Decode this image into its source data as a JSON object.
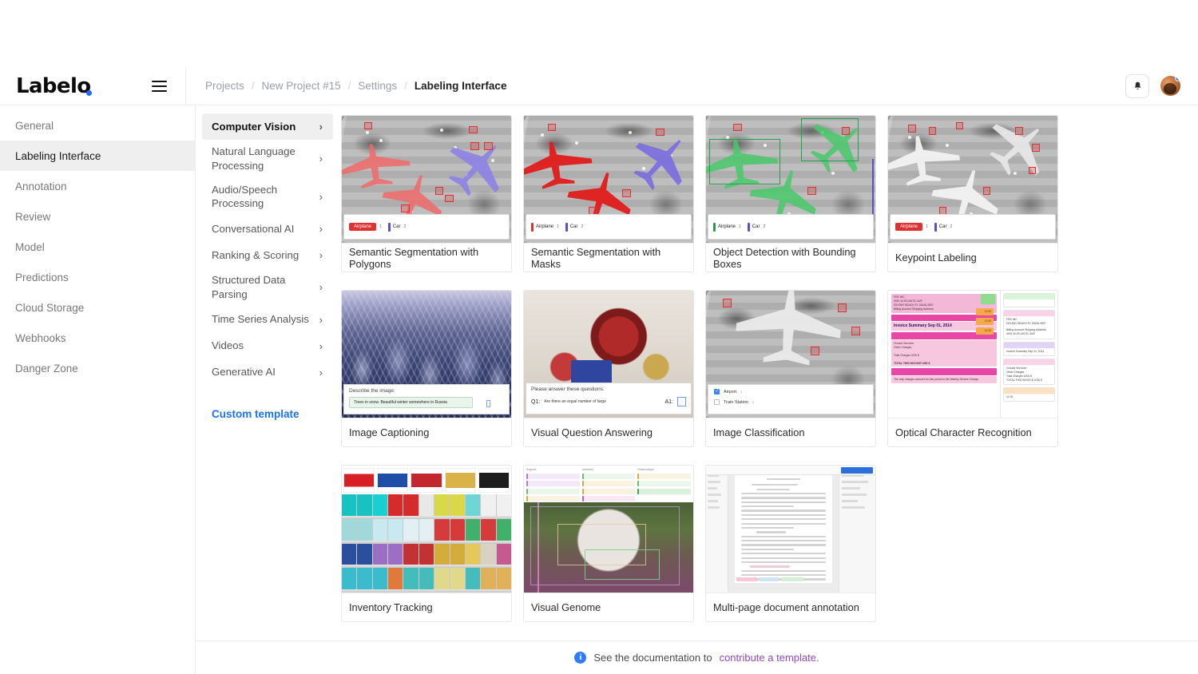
{
  "app": {
    "logo_text": "Label",
    "logo_accent_color": "#1f6bff"
  },
  "header": {
    "menu_icon": "hamburger-icon",
    "bell_icon": "bell-icon",
    "avatar_label": "user-avatar",
    "breadcrumb": [
      {
        "label": "Projects",
        "current": false
      },
      {
        "label": "New Project #15",
        "current": false
      },
      {
        "label": "Settings",
        "current": false
      },
      {
        "label": "Labeling Interface",
        "current": true
      }
    ],
    "separator": "/"
  },
  "sidebar": {
    "items": [
      {
        "label": "General",
        "active": false
      },
      {
        "label": "Labeling Interface",
        "active": true
      },
      {
        "label": "Annotation",
        "active": false
      },
      {
        "label": "Review",
        "active": false
      },
      {
        "label": "Model",
        "active": false
      },
      {
        "label": "Predictions",
        "active": false
      },
      {
        "label": "Cloud Storage",
        "active": false
      },
      {
        "label": "Webhooks",
        "active": false
      },
      {
        "label": "Danger Zone",
        "active": false
      }
    ]
  },
  "categories": {
    "items": [
      {
        "label": "Computer Vision",
        "active": true
      },
      {
        "label": "Natural Language Processing",
        "active": false
      },
      {
        "label": "Audio/Speech Processing",
        "active": false
      },
      {
        "label": "Conversational AI",
        "active": false
      },
      {
        "label": "Ranking & Scoring",
        "active": false
      },
      {
        "label": "Structured Data Parsing",
        "active": false
      },
      {
        "label": "Time Series Analysis",
        "active": false
      },
      {
        "label": "Videos",
        "active": false
      },
      {
        "label": "Generative AI",
        "active": false
      }
    ],
    "chevron": "›",
    "custom_template_label": "Custom template"
  },
  "templates": [
    {
      "title": "Semantic Segmentation with Polygons",
      "preview": "aerial-polygons",
      "tags": [
        {
          "text": "Airplane",
          "hotkey": "1",
          "color": "#e03131",
          "style": "chip"
        },
        {
          "text": "Car",
          "hotkey": "2",
          "color": "#5b4fcf",
          "style": "swatch"
        }
      ]
    },
    {
      "title": "Semantic Segmentation with Masks",
      "preview": "aerial-masks",
      "tags": [
        {
          "text": "Airplane",
          "hotkey": "1",
          "color": "#e03131",
          "style": "swatch"
        },
        {
          "text": "Car",
          "hotkey": "2",
          "color": "#5b4fcf",
          "style": "swatch"
        }
      ]
    },
    {
      "title": "Object Detection with Bounding Boxes",
      "preview": "aerial-boxes",
      "tags": [
        {
          "text": "Airplane",
          "hotkey": "1",
          "color": "#22a04a",
          "style": "swatch"
        },
        {
          "text": "Car",
          "hotkey": "2",
          "color": "#5b4fcf",
          "style": "swatch"
        }
      ]
    },
    {
      "title": "Keypoint Labeling",
      "preview": "aerial-keypoints",
      "tags": [
        {
          "text": "Airplane",
          "hotkey": "1",
          "color": "#e03131",
          "style": "chip"
        },
        {
          "text": "Car",
          "hotkey": "2",
          "color": "#5b4fcf",
          "style": "swatch"
        }
      ]
    },
    {
      "title": "Image Captioning",
      "preview": "snow-trees",
      "caption": {
        "prompt": "Describe the image:",
        "answer": "Trees in snow. Beautiful winter somewhere in Russia"
      }
    },
    {
      "title": "Visual Question Answering",
      "preview": "vqa-objects",
      "vqa": {
        "prompt": "Please answer these questions:",
        "question_label": "Q1:",
        "question_text": "Are there an equal number of large",
        "answer_label": "A1:"
      }
    },
    {
      "title": "Image Classification",
      "preview": "aerial-classification",
      "choices": [
        {
          "label": "Airport",
          "hotkey": "1",
          "checked": true
        },
        {
          "label": "Train Station",
          "hotkey": "2",
          "checked": false
        }
      ]
    },
    {
      "title": "Optical Character Recognition",
      "preview": "ocr-invoice",
      "ocr": {
        "blocks": [
          "FRS INC",
          "4931 W ATLANTIC AVE",
          "DELRAY BEACH FL 33445-3907",
          "Billing Account Shipping Address:",
          "Invoice Summary Sep 01, 2014",
          "Ground Services",
          "Other Charges",
          "Total Charges USD $",
          "TOTAL THIS INVOICE USD $",
          "11.00",
          "The only charges accrued for this period is the Weekly Service Charge."
        ]
      }
    },
    {
      "title": "Inventory Tracking",
      "preview": "retail-shelf"
    },
    {
      "title": "Visual Genome",
      "preview": "panda-regions",
      "regions": {
        "columns": [
          "Regions",
          "Attributes",
          "Relationships"
        ]
      }
    },
    {
      "title": "Multi-page document annotation",
      "preview": "pdf-document"
    }
  ],
  "footer": {
    "info_icon": "info-icon",
    "text": "See the documentation to",
    "link_text": "contribute a template.",
    "link_color": "#8f45c9"
  }
}
